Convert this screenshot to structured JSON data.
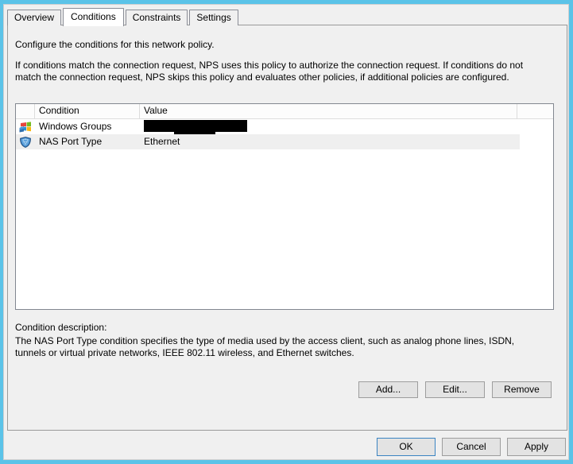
{
  "window": {
    "frame_color": "#5bc3e8",
    "background": "#f0f0f0"
  },
  "tabs": [
    {
      "label": "Overview",
      "active": false
    },
    {
      "label": "Conditions",
      "active": true
    },
    {
      "label": "Constraints",
      "active": false
    },
    {
      "label": "Settings",
      "active": false
    }
  ],
  "page": {
    "intro_line": "Configure the conditions for this network policy.",
    "intro_paragraph": "If conditions match the connection request, NPS uses this policy to authorize the connection request. If conditions do not match the connection request, NPS skips this policy and evaluates other policies, if additional policies are configured."
  },
  "conditions_list": {
    "columns": [
      "",
      "Condition",
      "Value",
      ""
    ],
    "rows": [
      {
        "icon": "windows-groups-icon",
        "condition": "Windows Groups",
        "value": "",
        "value_redacted": true,
        "selected": false
      },
      {
        "icon": "nas-port-type-icon",
        "condition": "NAS Port Type",
        "value": "Ethernet",
        "value_redacted": false,
        "selected": true
      }
    ]
  },
  "description": {
    "label": "Condition description:",
    "text": "The NAS Port Type condition specifies the type of media used by the access client, such as analog phone lines, ISDN, tunnels or virtual private networks, IEEE 802.11 wireless, and Ethernet switches."
  },
  "actions": {
    "add": "Add...",
    "edit": "Edit...",
    "remove": "Remove"
  },
  "footer": {
    "ok": "OK",
    "cancel": "Cancel",
    "apply": "Apply",
    "default_button": "OK",
    "focus_color": "#3a84c2"
  }
}
